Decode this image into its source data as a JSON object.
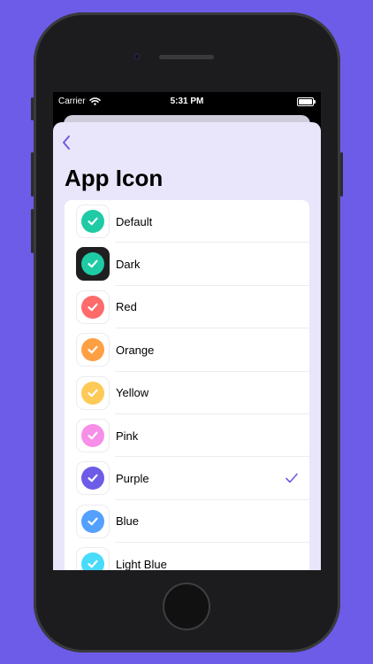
{
  "status_bar": {
    "carrier": "Carrier",
    "time": "5:31 PM",
    "battery_level": 1.0
  },
  "nav": {
    "back_icon": "chevron-left-icon",
    "title": "App Icon"
  },
  "colors": {
    "background": "#6c5ce7",
    "accent": "#6c5ce7",
    "sheet": "#e9e6fb"
  },
  "icons": [
    {
      "label": "Default",
      "color": "#1ecba5",
      "dark": false,
      "selected": false
    },
    {
      "label": "Dark",
      "color": "#1ecba5",
      "dark": true,
      "selected": false
    },
    {
      "label": "Red",
      "color": "#ff6b6b",
      "dark": false,
      "selected": false
    },
    {
      "label": "Orange",
      "color": "#ff9f43",
      "dark": false,
      "selected": false
    },
    {
      "label": "Yellow",
      "color": "#feca57",
      "dark": false,
      "selected": false
    },
    {
      "label": "Pink",
      "color": "#f78fe8",
      "dark": false,
      "selected": false
    },
    {
      "label": "Purple",
      "color": "#6c5ce7",
      "dark": false,
      "selected": true
    },
    {
      "label": "Blue",
      "color": "#54a0ff",
      "dark": false,
      "selected": false
    },
    {
      "label": "Light Blue",
      "color": "#48dbfb",
      "dark": false,
      "selected": false
    }
  ]
}
